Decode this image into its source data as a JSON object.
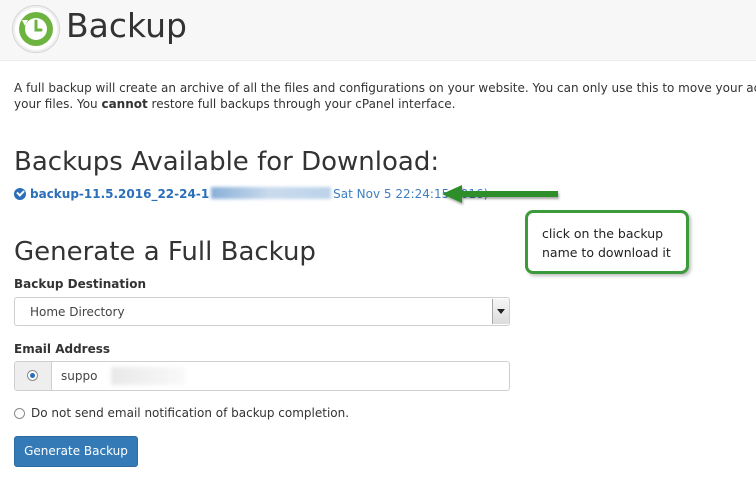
{
  "header": {
    "title": "Backup",
    "icon": "backup-clock-icon",
    "icon_color": "#6db33f"
  },
  "description": {
    "part1": "A full backup will create an archive of all the files and configurations on your website. You can only use this to move your accou",
    "part2_pre": "your files. You ",
    "part2_bold": "cannot",
    "part2_post": " restore full backups through your cPanel interface."
  },
  "download_section": {
    "heading": "Backups Available for Download:",
    "backup_name_visible": "backup-11.5.2016_22-24-1",
    "backup_date": "Sat Nov 5 22:24:15 2016)",
    "link_color": "#2a6fb8"
  },
  "callout": {
    "text_line1": "click on the backup",
    "text_line2": "name to download it",
    "border_color": "#3c9a3a"
  },
  "generate_section": {
    "heading": "Generate a Full Backup",
    "destination_label": "Backup Destination",
    "destination_value": "Home Directory",
    "email_label": "Email Address",
    "email_value": "suppo",
    "no_email_label": "Do not send email notification of backup completion.",
    "button_label": "Generate Backup",
    "button_color": "#337ab7"
  }
}
